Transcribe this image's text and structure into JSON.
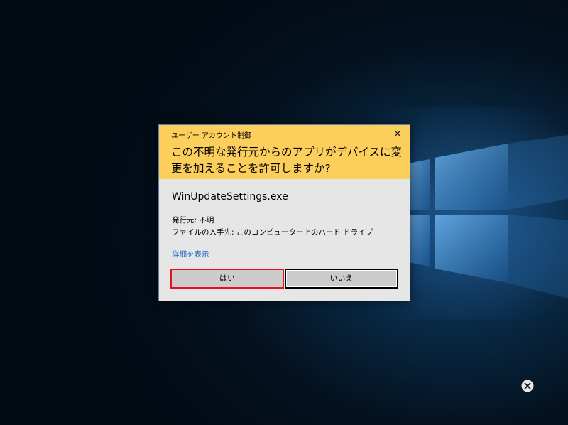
{
  "dialog": {
    "title": "ユーザー アカウント制御",
    "question": "この不明な発行元からのアプリがデバイスに変更を加えることを許可しますか?",
    "app_name": "WinUpdateSettings.exe",
    "publisher": "発行元: 不明",
    "origin": "ファイルの入手先: このコンピューター上のハード ドライブ",
    "details_link": "詳細を表示",
    "yes_label": "はい",
    "no_label": "いいえ",
    "close_glyph": "✕",
    "header_color": "#fccf5d",
    "highlight_color": "#e8101a"
  }
}
